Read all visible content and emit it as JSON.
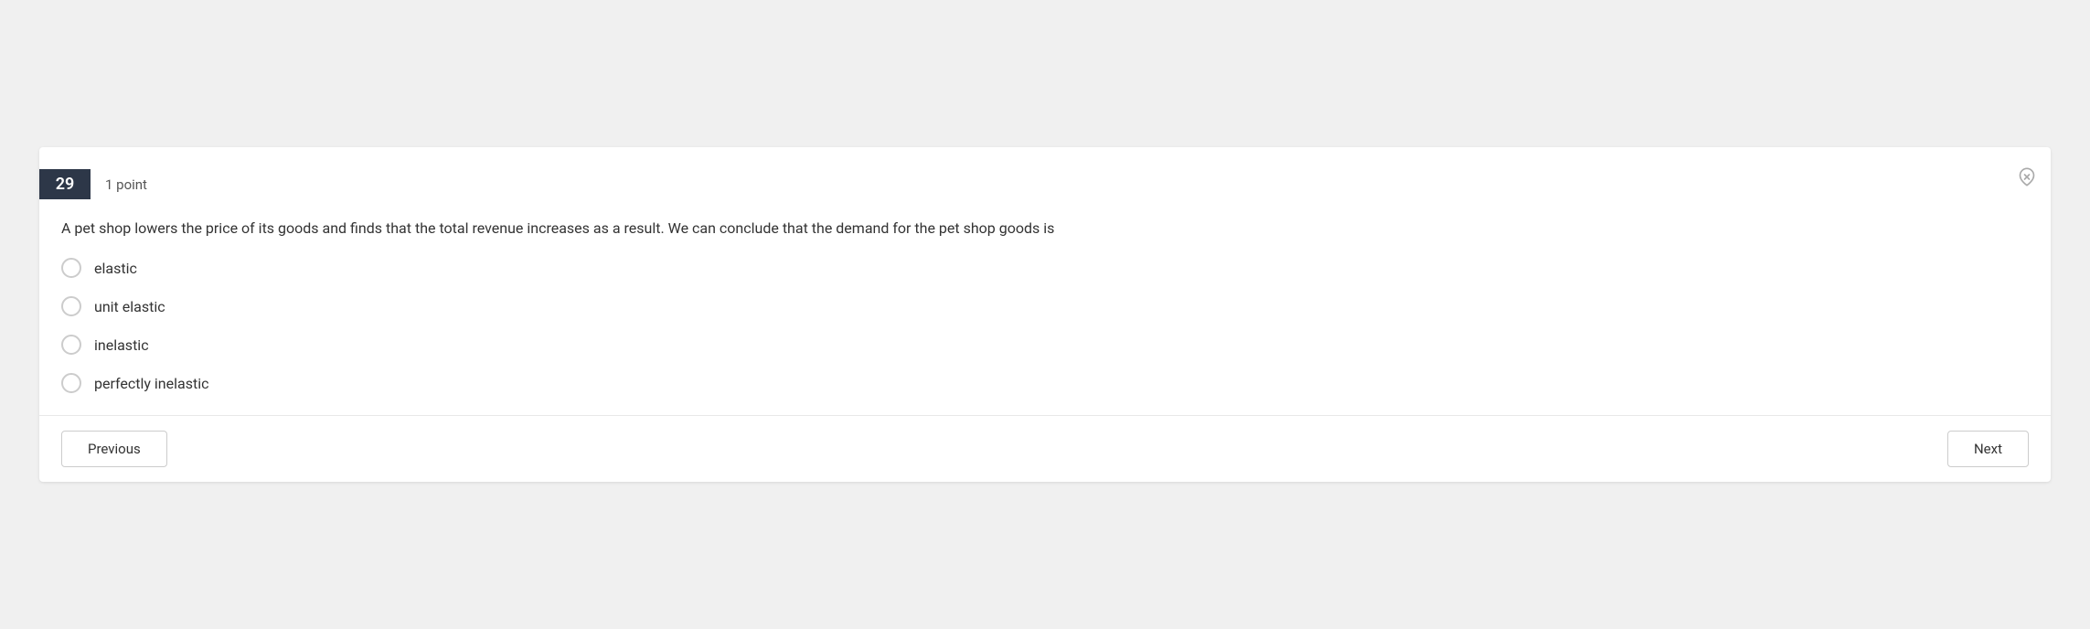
{
  "question": {
    "number": "29",
    "points_label": "1 point",
    "text": "A pet shop lowers the price of its goods and finds that the total revenue increases as a result. We can conclude that the demand for the pet shop goods is",
    "options": [
      {
        "id": "opt1",
        "label": "elastic"
      },
      {
        "id": "opt2",
        "label": "unit elastic"
      },
      {
        "id": "opt3",
        "label": "inelastic"
      },
      {
        "id": "opt4",
        "label": "perfectly inelastic"
      }
    ]
  },
  "navigation": {
    "previous_label": "Previous",
    "next_label": "Next"
  },
  "icons": {
    "pin": "📌"
  }
}
